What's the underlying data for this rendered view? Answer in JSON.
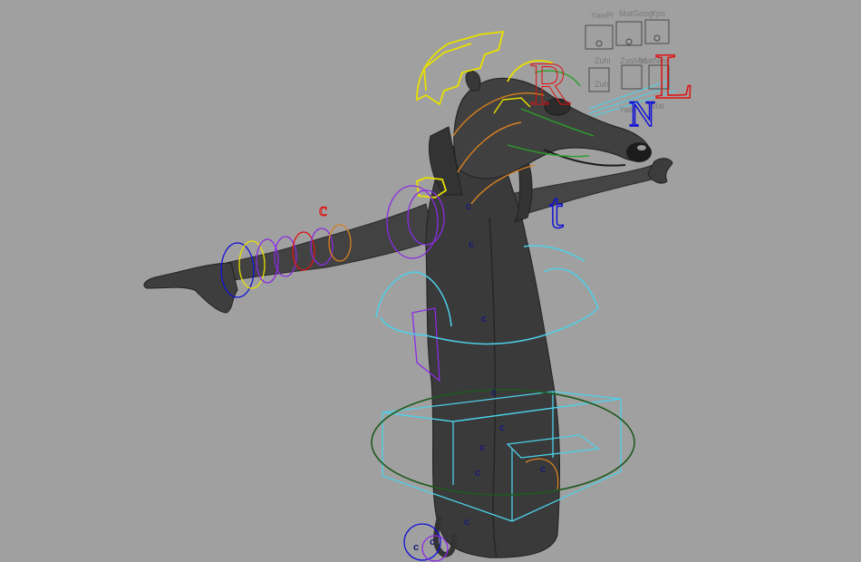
{
  "viewport": {
    "background": "#a0a0a0"
  },
  "face_panel": {
    "labels": [
      "YawPl",
      "MatGoog",
      "Xpo",
      "Zuhl",
      "ZygMat",
      "MatNew",
      "Zuhl",
      "Yaw",
      "Mat"
    ]
  },
  "rig_letters": [
    {
      "text": "R",
      "color": "#e01010"
    },
    {
      "text": "L",
      "color": "#e01010"
    },
    {
      "text": "N",
      "color": "#1010d8"
    },
    {
      "text": "t",
      "color": "#1010d8"
    },
    {
      "text": "c",
      "color": "#e01010"
    }
  ],
  "control_marks": [
    "c",
    "c",
    "c",
    "c",
    "c",
    "c",
    "c",
    "c",
    "c",
    "c",
    "c"
  ],
  "colors": {
    "body": "#3c3c3c",
    "body_dark": "#262626",
    "yellow": "#e8e000",
    "cyan": "#4cd0e8",
    "purple": "#8a2be2",
    "orange": "#d88020",
    "green": "#2aa02a",
    "dark_green": "#1e5a1e",
    "blue": "#1010d8",
    "red": "#e01010"
  }
}
